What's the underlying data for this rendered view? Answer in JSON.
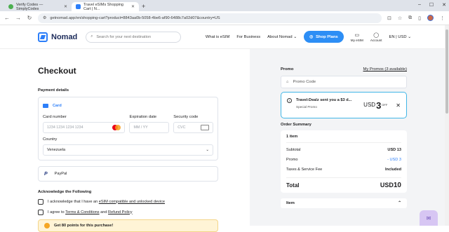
{
  "browser": {
    "tabs": [
      {
        "title": "Verify Codes — SimplyCodes",
        "favicon_color": "#4caf50"
      },
      {
        "title": "Travel eSIMs Shopping Cart | N...",
        "favicon_color": "#2d7ff9"
      }
    ],
    "url": "getnomad.app/en/shopping-cart?product=8843aa0b-5058-4be6-af90-6488c7a02d07&country=US"
  },
  "header": {
    "brand": "Nomad",
    "search_placeholder": "Search for your next destination",
    "nav": [
      "What is eSIM",
      "For Business",
      "About Nomad"
    ],
    "shop_button": "Shop Plans",
    "my_esim": "My eSIM",
    "account": "Account",
    "locale": "EN | USD"
  },
  "checkout": {
    "title": "Checkout",
    "payment_details": "Payment details",
    "card_tab": "Card",
    "card_number_label": "Card number",
    "card_number_placeholder": "1234 1234 1234 1234",
    "expiry_label": "Expiration date",
    "expiry_placeholder": "MM / YY",
    "cvc_label": "Security code",
    "cvc_placeholder": "CVC",
    "country_label": "Country",
    "country_value": "Venezuela",
    "paypal_label": "PayPal",
    "ack_title": "Acknowledge the Following",
    "ack1_prefix": "I acknowledge that I have an ",
    "ack1_link": "eSIM compatible and unlocked device",
    "ack2_prefix": "I agree to ",
    "ack2_link1": "Terms & Conditions",
    "ack2_mid": " and ",
    "ack2_link2": "Refund Policy",
    "points_banner": "Get 80 points for this purchase!"
  },
  "summary": {
    "promo_title": "Promo",
    "my_promos": "My Promos (3 available)",
    "promo_placeholder": "Promo Code",
    "deal_title": "Travel-Dealz sent you a $3 d...",
    "deal_sub": "Special Promo",
    "deal_currency": "USD",
    "deal_amount": "3",
    "deal_off": "OFF",
    "order_summary": "Order Summary",
    "items": "1 item",
    "subtotal_label": "Subtotal",
    "subtotal_value": "USD 13",
    "promo_label": "Promo",
    "promo_value": "- USD 3",
    "fee_label": "Taxes & Service Fee",
    "fee_value": "Included",
    "total_label": "Total",
    "total_currency": "USD",
    "total_value": "10",
    "item_label": "Item"
  }
}
